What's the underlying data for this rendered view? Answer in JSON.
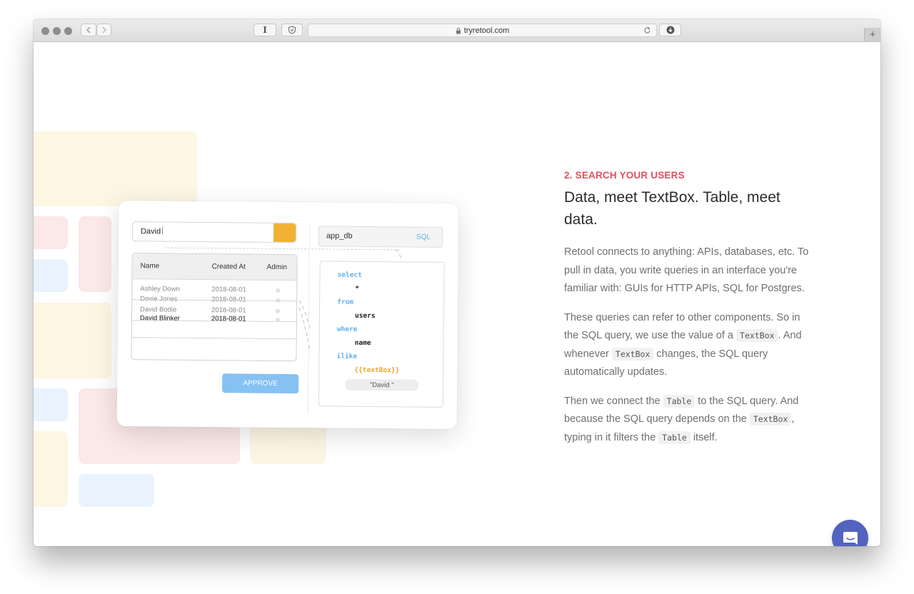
{
  "browser": {
    "url": "tryretool.com",
    "reader_glyph": "I",
    "new_tab_glyph": "+",
    "back_icon": "chevron-left-icon",
    "forward_icon": "chevron-right-icon"
  },
  "illustration": {
    "textbox_value": "David",
    "table": {
      "headers": [
        "Name",
        "Created At",
        "Admin"
      ],
      "rows": [
        {
          "name": "Ashley Down",
          "created": "2018-08-01"
        },
        {
          "name": "Dovie Jones",
          "created": "2018-08-01"
        },
        {
          "name": "David Bodie",
          "created": "2018-08-01"
        },
        {
          "name": "David Blinker",
          "created": "2018-08-01"
        }
      ]
    },
    "approve_label": "APPROVE",
    "db_name": "app_db",
    "db_mode": "SQL",
    "sql": {
      "select": "select",
      "star": "*",
      "from": "from",
      "table": "users",
      "where": "where",
      "column": "name",
      "ilike": "ilike",
      "template": "{{textBox}}",
      "resolved": "\"David \""
    }
  },
  "section": {
    "eyebrow": "2. SEARCH YOUR USERS",
    "headline": "Data, meet TextBox. Table, meet data.",
    "p1": "Retool connects to anything: APIs, databases, etc. To pull in data, you write queries in an interface you're familiar with: GUIs for HTTP APIs, SQL for Postgres.",
    "p2": {
      "a": "These queries can refer to other components. So in the SQL query, we use the value of a ",
      "code1": "TextBox",
      "b": ". And whenever ",
      "code2": "TextBox",
      "c": " changes, the SQL query automatically updates."
    },
    "p3": {
      "a": "Then we connect the ",
      "code1": "Table",
      "b": " to the SQL query. And because the SQL query depends on the ",
      "code2": "TextBox",
      "c": ", typing in it filters the ",
      "code3": "Table",
      "d": " itself."
    }
  },
  "chat_widget": {
    "icon": "chat-icon"
  },
  "colors": {
    "accent": "#e0505f",
    "button_blue": "#86c1f4",
    "input_orange": "#f1b033",
    "chat": "#5264bf"
  }
}
